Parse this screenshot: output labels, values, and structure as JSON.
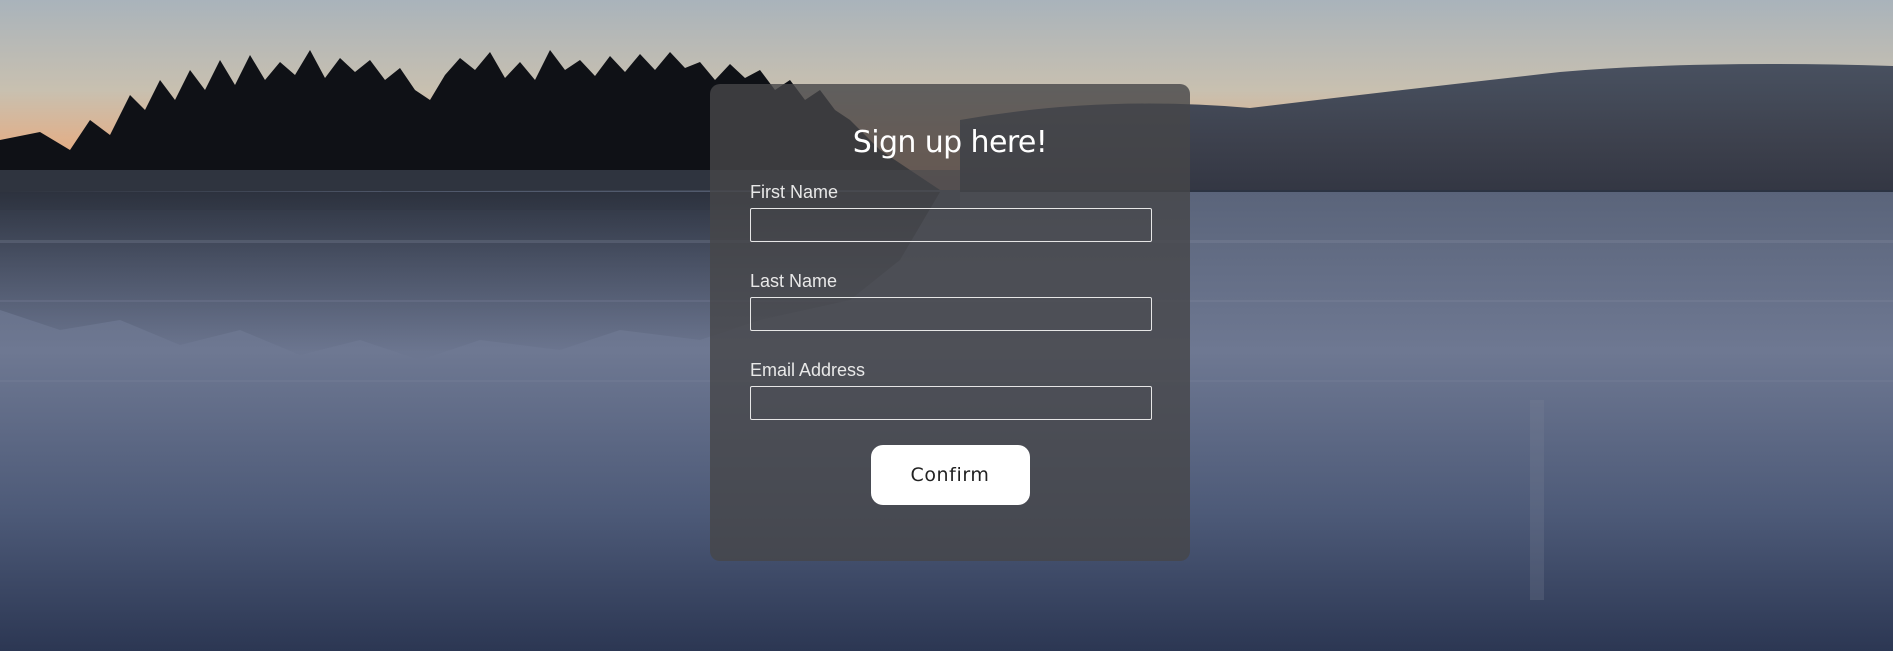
{
  "form": {
    "title": "Sign up here!",
    "fields": [
      {
        "label": "First Name",
        "value": "",
        "placeholder": ""
      },
      {
        "label": "Last Name",
        "value": "",
        "placeholder": ""
      },
      {
        "label": "Email Address",
        "value": "",
        "placeholder": ""
      }
    ],
    "confirm_label": "Confirm"
  },
  "colors": {
    "panel_bg": "#464648",
    "button_bg": "#ffffff",
    "text": "#ffffff"
  }
}
